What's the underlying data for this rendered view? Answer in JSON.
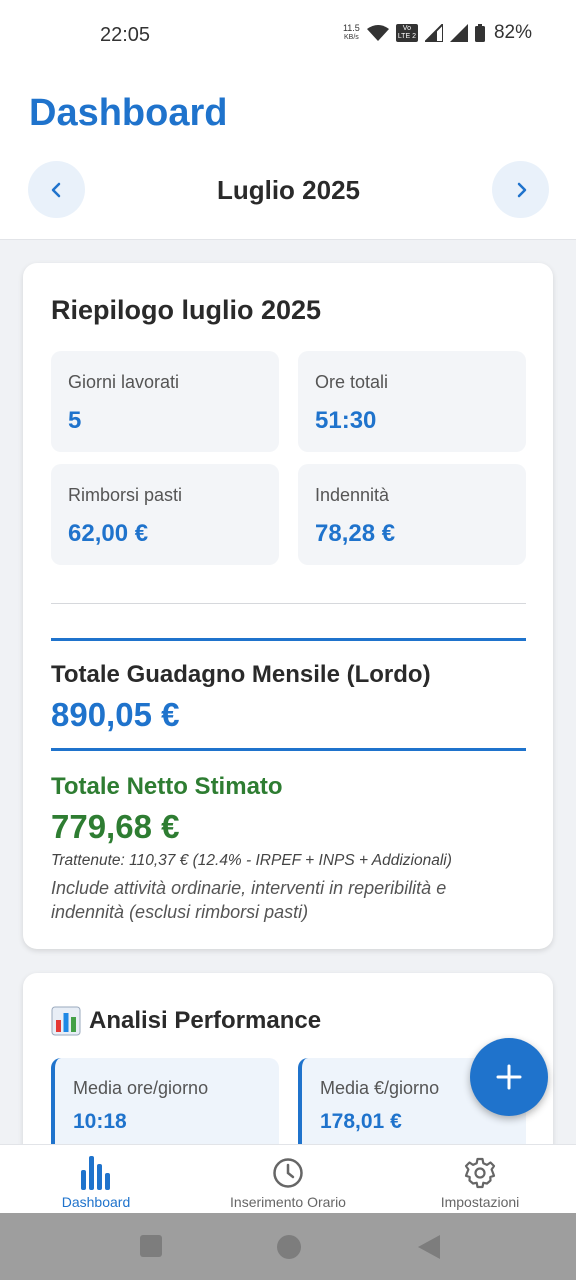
{
  "status_bar": {
    "time": "22:05",
    "net_speed_value": "11.5",
    "net_speed_unit": "KB/s",
    "volte_top": "Vo",
    "volte_bottom": "LTE 2",
    "battery_percent": "82%"
  },
  "header": {
    "title": "Dashboard",
    "month": "Luglio 2025",
    "prev_icon": "chevron-left-icon",
    "next_icon": "chevron-right-icon"
  },
  "summary": {
    "title": "Riepilogo luglio 2025",
    "stats": [
      {
        "label": "Giorni lavorati",
        "value": "5"
      },
      {
        "label": "Ore totali",
        "value": "51:30"
      },
      {
        "label": "Rimborsi pasti",
        "value": "62,00 €"
      },
      {
        "label": "Indennità",
        "value": "78,28 €"
      }
    ],
    "gross_label": "Totale Guadagno Mensile (Lordo)",
    "gross_value": "890,05 €",
    "net_label": "Totale Netto Stimato",
    "net_value": "779,68 €",
    "deductions": "Trattenute: 110,37 € (12.4% - IRPEF + INPS + Addizionali)",
    "note": "Include attività ordinarie, interventi in reperibilità e indennità (esclusi rimborsi pasti)"
  },
  "performance": {
    "title": "Analisi Performance",
    "icon": "bar-chart-icon",
    "tiles": [
      {
        "label": "Media ore/giorno",
        "value": "10:18"
      },
      {
        "label": "Media €/giorno",
        "value": "178,01 €"
      }
    ]
  },
  "fab": {
    "icon": "plus-icon"
  },
  "bottom_nav": [
    {
      "label": "Dashboard",
      "icon": "bar-chart-icon",
      "active": true
    },
    {
      "label": "Inserimento Orario",
      "icon": "clock-icon",
      "active": false
    },
    {
      "label": "Impostazioni",
      "icon": "gear-icon",
      "active": false
    }
  ],
  "colors": {
    "primary": "#1f73cc",
    "net_green": "#2e7d32",
    "background": "#f0f2f5"
  }
}
